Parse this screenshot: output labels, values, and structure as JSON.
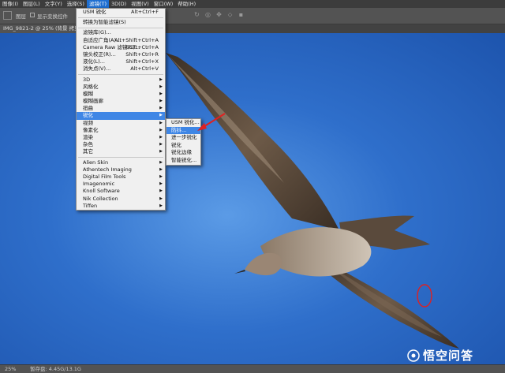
{
  "menubar": {
    "items": [
      {
        "label": "图像(I)"
      },
      {
        "label": "图层(L)"
      },
      {
        "label": "文字(Y)"
      },
      {
        "label": "选择(S)"
      },
      {
        "label": "滤镜(T)",
        "active": true
      },
      {
        "label": "3D(D)"
      },
      {
        "label": "视图(V)"
      },
      {
        "label": "窗口(W)"
      },
      {
        "label": "帮助(H)"
      }
    ]
  },
  "options": {
    "mode_value": "图层",
    "sample_all_label": "显示变换控件"
  },
  "document": {
    "tab_label": "IMG_9821-2 @ 25% (背景 拷贝, R"
  },
  "filter_menu": {
    "groups": [
      [
        {
          "label": "USM 锐化",
          "shortcut": "Alt+Ctrl+F"
        }
      ],
      [
        {
          "label": "转换为智能滤镜(S)"
        }
      ],
      [
        {
          "label": "滤镜库(G)..."
        },
        {
          "label": "自适应广角(A)...",
          "shortcut": "Alt+Shift+Ctrl+A"
        },
        {
          "label": "Camera Raw 滤镜(C)...",
          "shortcut": "Shift+Ctrl+A"
        },
        {
          "label": "镜头校正(R)...",
          "shortcut": "Shift+Ctrl+R"
        },
        {
          "label": "液化(L)...",
          "shortcut": "Shift+Ctrl+X"
        },
        {
          "label": "消失点(V)...",
          "shortcut": "Alt+Ctrl+V"
        }
      ],
      [
        {
          "label": "3D",
          "sub": true
        },
        {
          "label": "风格化",
          "sub": true
        },
        {
          "label": "模糊",
          "sub": true
        },
        {
          "label": "模糊画廊",
          "sub": true
        },
        {
          "label": "扭曲",
          "sub": true
        },
        {
          "label": "锐化",
          "sub": true,
          "highlight": true
        },
        {
          "label": "视频",
          "sub": true
        },
        {
          "label": "像素化",
          "sub": true
        },
        {
          "label": "渲染",
          "sub": true
        },
        {
          "label": "杂色",
          "sub": true
        },
        {
          "label": "其它",
          "sub": true
        }
      ],
      [
        {
          "label": "Alien Skin",
          "sub": true
        },
        {
          "label": "Athentech Imaging",
          "sub": true
        },
        {
          "label": "Digital Film Tools",
          "sub": true
        },
        {
          "label": "Imagenomic",
          "sub": true
        },
        {
          "label": "Knoll Software",
          "sub": true
        },
        {
          "label": "Nik Collection",
          "sub": true
        },
        {
          "label": "Tiffen",
          "sub": true
        }
      ]
    ]
  },
  "sharpen_submenu": {
    "items": [
      {
        "label": "USM 锐化..."
      },
      {
        "label": "防抖...",
        "highlight": true
      },
      {
        "label": "进一步锐化"
      },
      {
        "label": "锐化"
      },
      {
        "label": "锐化边缘"
      },
      {
        "label": "智能锐化..."
      }
    ]
  },
  "status": {
    "zoom": "25%",
    "doc_info": "暂存盘: 4.45G/13.1G"
  },
  "watermark": {
    "text": "悟空问答"
  },
  "colors": {
    "highlight": "#3f86e5",
    "annotation": "#e02020"
  }
}
